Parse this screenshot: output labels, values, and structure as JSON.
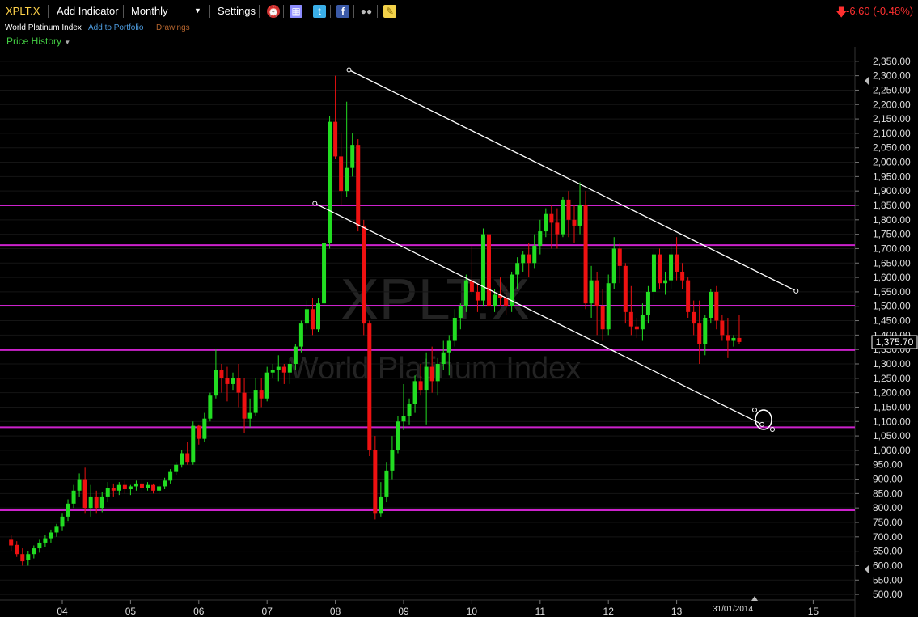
{
  "toolbar": {
    "symbol": "XPLT.X",
    "add_indicator": "Add Indicator",
    "interval": "Monthly",
    "settings": "Settings",
    "icons": [
      "alarm-clock-icon",
      "books-icon",
      "twitter-icon",
      "facebook-icon",
      "binoculars-icon",
      "sticky-note-icon"
    ],
    "change": "-6.60 (-0.48%)",
    "change_color": "#ff3030"
  },
  "subbar": {
    "name": "World Platinum Index",
    "add_to_portfolio": "Add to Portfolio",
    "drawings": "Drawings",
    "price_history": "Price History"
  },
  "chart_data": {
    "type": "candlestick",
    "watermark_symbol": "XPLT.X",
    "watermark_name": "World Platinum Index",
    "x_ticks": [
      "04",
      "05",
      "06",
      "07",
      "08",
      "09",
      "10",
      "11",
      "12",
      "13",
      "15"
    ],
    "date_marker": "31/01/2014",
    "y_ticks": [
      2350,
      2300,
      2250,
      2200,
      2150,
      2100,
      2050,
      2000,
      1950,
      1900,
      1850,
      1800,
      1750,
      1700,
      1650,
      1600,
      1550,
      1500,
      1450,
      1400,
      1350,
      1300,
      1250,
      1200,
      1150,
      1100,
      1050,
      1000,
      950,
      900,
      850,
      800,
      750,
      700,
      650,
      600,
      550,
      500
    ],
    "ylim": [
      480,
      2380
    ],
    "last_price": "1,375.70",
    "last_price_value": 1375.7,
    "horizontal_lines": [
      1850,
      1712,
      1502,
      1348,
      1080,
      792
    ],
    "horizontal_line_color": "#cc22cc",
    "trendlines": [
      {
        "x1": 2008.2,
        "y1": 2320,
        "x2": 2014.75,
        "y2": 1553
      },
      {
        "x1": 2007.7,
        "y1": 1857,
        "x2": 2014.25,
        "y2": 1090
      }
    ],
    "up_color": "#22dd22",
    "down_color": "#ee1111",
    "candles_ohlc": [
      [
        690,
        705,
        650,
        670
      ],
      [
        672,
        685,
        630,
        640
      ],
      [
        640,
        660,
        600,
        615
      ],
      [
        620,
        650,
        600,
        640
      ],
      [
        640,
        670,
        625,
        660
      ],
      [
        660,
        690,
        645,
        680
      ],
      [
        680,
        705,
        665,
        695
      ],
      [
        695,
        725,
        680,
        715
      ],
      [
        715,
        745,
        700,
        735
      ],
      [
        735,
        780,
        720,
        770
      ],
      [
        770,
        830,
        755,
        815
      ],
      [
        815,
        880,
        800,
        860
      ],
      [
        860,
        920,
        840,
        900
      ],
      [
        900,
        940,
        780,
        800
      ],
      [
        800,
        880,
        770,
        840
      ],
      [
        840,
        860,
        780,
        800
      ],
      [
        800,
        855,
        785,
        840
      ],
      [
        840,
        890,
        820,
        870
      ],
      [
        870,
        885,
        840,
        860
      ],
      [
        860,
        890,
        845,
        880
      ],
      [
        880,
        895,
        850,
        865
      ],
      [
        865,
        880,
        845,
        875
      ],
      [
        875,
        895,
        860,
        885
      ],
      [
        885,
        900,
        855,
        870
      ],
      [
        870,
        890,
        860,
        880
      ],
      [
        880,
        885,
        850,
        860
      ],
      [
        860,
        885,
        850,
        875
      ],
      [
        875,
        905,
        865,
        895
      ],
      [
        895,
        935,
        885,
        925
      ],
      [
        925,
        960,
        915,
        950
      ],
      [
        950,
        1000,
        940,
        990
      ],
      [
        990,
        1030,
        950,
        960
      ],
      [
        960,
        1100,
        950,
        1085
      ],
      [
        1085,
        1090,
        1020,
        1040
      ],
      [
        1040,
        1130,
        1030,
        1110
      ],
      [
        1110,
        1200,
        1100,
        1190
      ],
      [
        1190,
        1350,
        1180,
        1280
      ],
      [
        1280,
        1300,
        1200,
        1250
      ],
      [
        1250,
        1290,
        1170,
        1230
      ],
      [
        1230,
        1270,
        1210,
        1250
      ],
      [
        1250,
        1300,
        1150,
        1200
      ],
      [
        1200,
        1250,
        1060,
        1110
      ],
      [
        1110,
        1180,
        1080,
        1130
      ],
      [
        1130,
        1250,
        1120,
        1210
      ],
      [
        1210,
        1250,
        1150,
        1180
      ],
      [
        1180,
        1290,
        1170,
        1270
      ],
      [
        1270,
        1300,
        1250,
        1280
      ],
      [
        1280,
        1330,
        1240,
        1290
      ],
      [
        1290,
        1300,
        1230,
        1270
      ],
      [
        1270,
        1320,
        1230,
        1300
      ],
      [
        1300,
        1370,
        1280,
        1360
      ],
      [
        1360,
        1450,
        1340,
        1440
      ],
      [
        1440,
        1520,
        1420,
        1490
      ],
      [
        1490,
        1530,
        1400,
        1420
      ],
      [
        1420,
        1530,
        1410,
        1510
      ],
      [
        1510,
        1730,
        1500,
        1720
      ],
      [
        1720,
        2160,
        1700,
        2140
      ],
      [
        2140,
        2300,
        2010,
        2020
      ],
      [
        2020,
        2100,
        1850,
        1900
      ],
      [
        1900,
        2210,
        1880,
        1980
      ],
      [
        1980,
        2100,
        1950,
        2060
      ],
      [
        2060,
        2080,
        1760,
        1780
      ],
      [
        1780,
        1800,
        1400,
        1440
      ],
      [
        1440,
        1450,
        980,
        1000
      ],
      [
        1000,
        1050,
        760,
        780
      ],
      [
        780,
        890,
        770,
        840
      ],
      [
        840,
        960,
        820,
        930
      ],
      [
        930,
        1050,
        900,
        1000
      ],
      [
        1000,
        1120,
        990,
        1100
      ],
      [
        1100,
        1230,
        1070,
        1120
      ],
      [
        1120,
        1180,
        1090,
        1160
      ],
      [
        1160,
        1260,
        1130,
        1240
      ],
      [
        1240,
        1300,
        1190,
        1210
      ],
      [
        1210,
        1340,
        1090,
        1290
      ],
      [
        1290,
        1360,
        1200,
        1240
      ],
      [
        1240,
        1320,
        1190,
        1300
      ],
      [
        1300,
        1380,
        1280,
        1340
      ],
      [
        1340,
        1400,
        1260,
        1380
      ],
      [
        1380,
        1490,
        1360,
        1460
      ],
      [
        1460,
        1510,
        1420,
        1500
      ],
      [
        1500,
        1610,
        1480,
        1590
      ],
      [
        1590,
        1710,
        1540,
        1550
      ],
      [
        1550,
        1580,
        1480,
        1520
      ],
      [
        1520,
        1770,
        1500,
        1750
      ],
      [
        1750,
        1760,
        1460,
        1500
      ],
      [
        1500,
        1560,
        1480,
        1540
      ],
      [
        1540,
        1600,
        1500,
        1530
      ],
      [
        1530,
        1570,
        1470,
        1500
      ],
      [
        1500,
        1620,
        1480,
        1610
      ],
      [
        1610,
        1670,
        1560,
        1650
      ],
      [
        1650,
        1690,
        1620,
        1680
      ],
      [
        1680,
        1720,
        1600,
        1650
      ],
      [
        1650,
        1750,
        1630,
        1710
      ],
      [
        1710,
        1800,
        1680,
        1760
      ],
      [
        1760,
        1840,
        1740,
        1820
      ],
      [
        1820,
        1850,
        1700,
        1790
      ],
      [
        1790,
        1840,
        1700,
        1750
      ],
      [
        1750,
        1880,
        1740,
        1870
      ],
      [
        1870,
        1900,
        1740,
        1800
      ],
      [
        1800,
        1850,
        1720,
        1780
      ],
      [
        1780,
        1930,
        1750,
        1850
      ],
      [
        1850,
        1900,
        1490,
        1510
      ],
      [
        1510,
        1640,
        1460,
        1590
      ],
      [
        1590,
        1620,
        1400,
        1500
      ],
      [
        1500,
        1560,
        1380,
        1420
      ],
      [
        1420,
        1610,
        1400,
        1580
      ],
      [
        1580,
        1740,
        1560,
        1700
      ],
      [
        1700,
        1720,
        1580,
        1640
      ],
      [
        1640,
        1650,
        1440,
        1480
      ],
      [
        1480,
        1570,
        1400,
        1430
      ],
      [
        1430,
        1460,
        1390,
        1420
      ],
      [
        1420,
        1510,
        1380,
        1470
      ],
      [
        1470,
        1570,
        1440,
        1550
      ],
      [
        1550,
        1700,
        1520,
        1680
      ],
      [
        1680,
        1700,
        1560,
        1580
      ],
      [
        1580,
        1620,
        1540,
        1590
      ],
      [
        1590,
        1720,
        1560,
        1680
      ],
      [
        1680,
        1740,
        1590,
        1620
      ],
      [
        1620,
        1650,
        1560,
        1590
      ],
      [
        1590,
        1600,
        1460,
        1480
      ],
      [
        1480,
        1520,
        1400,
        1440
      ],
      [
        1440,
        1520,
        1300,
        1370
      ],
      [
        1370,
        1470,
        1330,
        1460
      ],
      [
        1460,
        1560,
        1440,
        1550
      ],
      [
        1550,
        1570,
        1420,
        1450
      ],
      [
        1450,
        1470,
        1380,
        1400
      ],
      [
        1400,
        1460,
        1320,
        1380
      ],
      [
        1380,
        1400,
        1360,
        1390
      ],
      [
        1390,
        1470,
        1370,
        1376
      ]
    ]
  }
}
